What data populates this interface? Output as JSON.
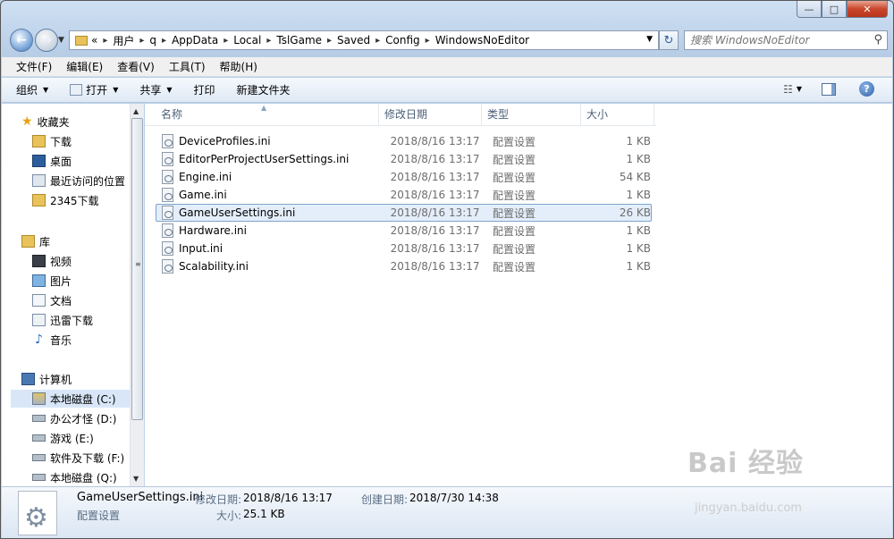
{
  "window": {
    "caption_buttons": [
      "—",
      "□",
      "✕"
    ]
  },
  "address": {
    "breadcrumbs": [
      "«",
      "用户",
      "q",
      "AppData",
      "Local",
      "TslGame",
      "Saved",
      "Config",
      "WindowsNoEditor"
    ],
    "search_placeholder": "搜索 WindowsNoEditor"
  },
  "menubar": [
    "文件(F)",
    "编辑(E)",
    "查看(V)",
    "工具(T)",
    "帮助(H)"
  ],
  "toolbar": {
    "organize": "组织",
    "open": "打开",
    "share": "共享",
    "print": "打印",
    "new_folder": "新建文件夹"
  },
  "navpane": {
    "favorites": {
      "label": "收藏夹",
      "items": [
        "下载",
        "桌面",
        "最近访问的位置",
        "2345下载"
      ]
    },
    "libraries": {
      "label": "库",
      "items": [
        "视频",
        "图片",
        "文档",
        "迅雷下载",
        "音乐"
      ]
    },
    "computer": {
      "label": "计算机",
      "items": [
        "本地磁盘 (C:)",
        "办公才怪 (D:)",
        "游戏 (E:)",
        "软件及下载 (F:)",
        "本地磁盘 (Q:)"
      ]
    }
  },
  "columns": [
    "名称",
    "修改日期",
    "类型",
    "大小"
  ],
  "files": [
    {
      "name": "DeviceProfiles.ini",
      "date": "2018/8/16 13:17",
      "type": "配置设置",
      "size": "1 KB"
    },
    {
      "name": "EditorPerProjectUserSettings.ini",
      "date": "2018/8/16 13:17",
      "type": "配置设置",
      "size": "1 KB"
    },
    {
      "name": "Engine.ini",
      "date": "2018/8/16 13:17",
      "type": "配置设置",
      "size": "54 KB"
    },
    {
      "name": "Game.ini",
      "date": "2018/8/16 13:17",
      "type": "配置设置",
      "size": "1 KB"
    },
    {
      "name": "GameUserSettings.ini",
      "date": "2018/8/16 13:17",
      "type": "配置设置",
      "size": "26 KB"
    },
    {
      "name": "Hardware.ini",
      "date": "2018/8/16 13:17",
      "type": "配置设置",
      "size": "1 KB"
    },
    {
      "name": "Input.ini",
      "date": "2018/8/16 13:17",
      "type": "配置设置",
      "size": "1 KB"
    },
    {
      "name": "Scalability.ini",
      "date": "2018/8/16 13:17",
      "type": "配置设置",
      "size": "1 KB"
    }
  ],
  "selected_file": "GameUserSettings.ini",
  "details": {
    "name": "GameUserSettings.ini",
    "type": "配置设置",
    "modified_label": "修改日期:",
    "modified_value": "2018/8/16 13:17",
    "created_label": "创建日期:",
    "created_value": "2018/7/30 14:38",
    "size_label": "大小:",
    "size_value": "25.1 KB"
  },
  "watermark": {
    "brand": "Bai 经验",
    "url": "jingyan.baidu.com"
  }
}
